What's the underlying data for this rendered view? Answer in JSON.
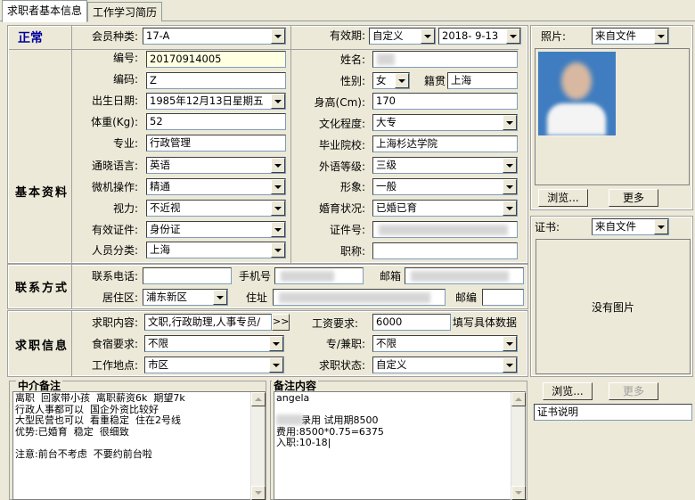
{
  "tabs": [
    "求职者基本信息",
    "工作学习简历"
  ],
  "status": "正常",
  "sections": {
    "basic": "基本资料",
    "contact": "联系方式",
    "job": "求职信息"
  },
  "labels": {
    "member_type": "会员种类:",
    "validity": "有效期:",
    "number": "编号:",
    "name": "姓名:",
    "code": "编码:",
    "gender": "性别:",
    "native": "籍贯",
    "birth": "出生日期:",
    "height": "身高(Cm):",
    "weight": "体重(Kg):",
    "education": "文化程度:",
    "major": "专业:",
    "school": "毕业院校:",
    "language": "通晓语言:",
    "lang_level": "外语等级:",
    "computer": "微机操作:",
    "appearance": "形象:",
    "vision": "视力:",
    "marital": "婚育状况:",
    "id_type": "有效证件:",
    "id_no": "证件号:",
    "category": "人员分类:",
    "title": "职称:",
    "phone": "联系电话:",
    "mobile": "手机号",
    "email": "邮箱",
    "residence": "居住区:",
    "address": "住址",
    "zipcode": "邮编",
    "job_content": "求职内容:",
    "salary": "工资要求:",
    "salary_hint": "填写具体数据",
    "board": "食宿要求:",
    "part_time": "专/兼职:",
    "location": "工作地点:",
    "job_status": "求职状态:"
  },
  "values": {
    "member_type": "17-A",
    "validity_type": "自定义",
    "validity_date": "2018- 9-13",
    "number": "20170914005",
    "code": "Z",
    "gender": "女",
    "native": "上海",
    "birth": "1985年12月13日星期五",
    "height": "170",
    "weight": "52",
    "education": "大专",
    "major": "行政管理",
    "school": "上海杉达学院",
    "language": "英语",
    "lang_level": "三级",
    "computer": "精通",
    "appearance": "一般",
    "vision": "不近视",
    "marital": "已婚已育",
    "id_type": "身份证",
    "category": "上海",
    "residence": "浦东新区",
    "job_content": "文职,行政助理,人事专员/",
    "salary": "6000",
    "board": "不限",
    "part_time": "不限",
    "location": "市区",
    "job_status": "自定义"
  },
  "photo": {
    "label": "照片:",
    "source": "来自文件",
    "browse": "浏览...",
    "more": "更多"
  },
  "certificate": {
    "label": "证书:",
    "source": "来自文件",
    "no_image": "没有图片",
    "browse": "浏览...",
    "more": "更多",
    "desc": "证书说明"
  },
  "more_btn": ">>",
  "agent_notes": {
    "title": "中介备注",
    "text": "离职  回家带小孩  离职薪资6k  期望7k\n行政人事都可以  国企外资比较好\n大型民营也可以  看重稳定  住在2号线\n优势:已婚育  稳定  很细致\n\n注意:前台不考虑  不要约前台啦"
  },
  "remarks": {
    "title": "备注内容",
    "text": "angela\n\n        录用 试用期8500\n费用:8500*0.75=6375\n入职:10-18|"
  },
  "colors": {
    "status": "#0000a0",
    "bg": "#ece9d8",
    "photo_bg": "#3f7dc0"
  }
}
